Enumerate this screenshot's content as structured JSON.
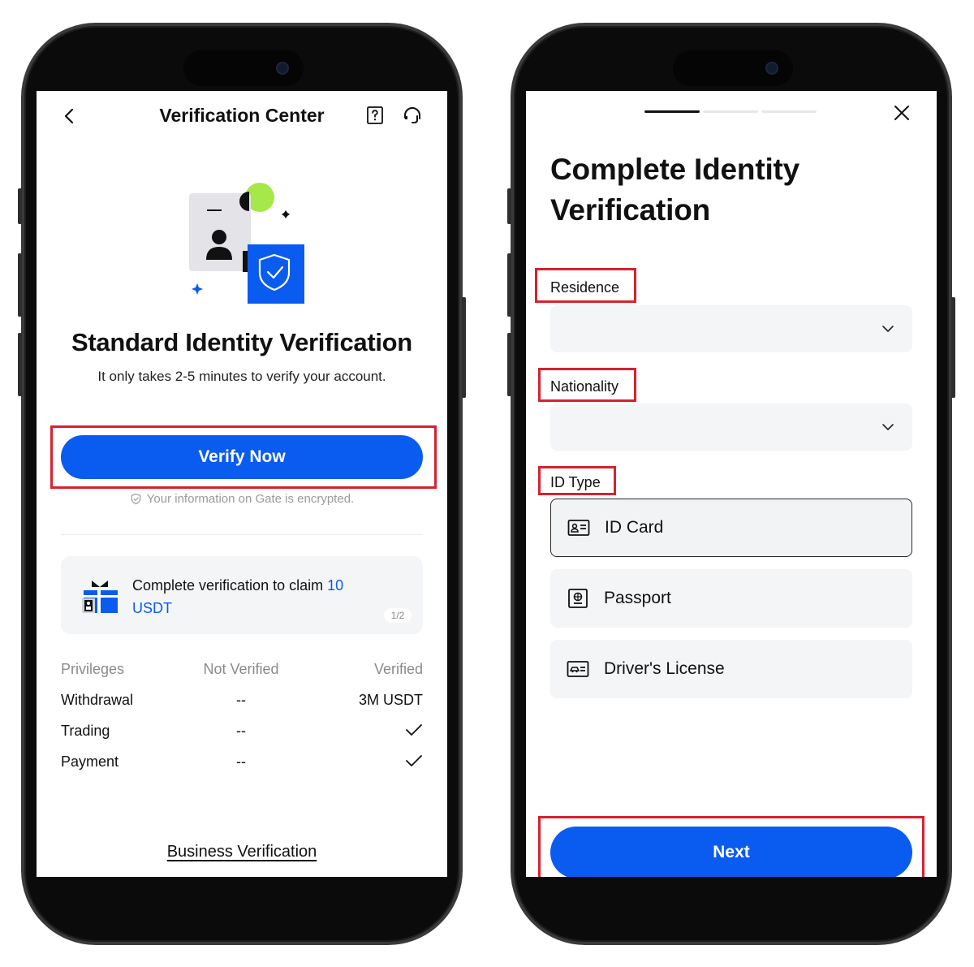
{
  "left": {
    "nav": {
      "title": "Verification Center"
    },
    "heading": "Standard Identity Verification",
    "subheading": "It only takes 2-5 minutes to verify your account.",
    "verify_button": "Verify Now",
    "encrypted_note": "Your information on Gate is encrypted.",
    "promo": {
      "text_prefix": "Complete verification to claim ",
      "amount": "10",
      "currency": "USDT",
      "page": "1/2"
    },
    "privileges": {
      "headers": [
        "Privileges",
        "Not Verified",
        "Verified"
      ],
      "rows": [
        {
          "name": "Withdrawal",
          "not_verified": "--",
          "verified": "3M USDT"
        },
        {
          "name": "Trading",
          "not_verified": "--",
          "verified": "check-icon"
        },
        {
          "name": "Payment",
          "not_verified": "--",
          "verified": "check-icon"
        }
      ]
    },
    "business_link": "Business Verification"
  },
  "right": {
    "progress": {
      "steps": 3,
      "current": 1
    },
    "heading": "Complete Identity Verification",
    "residence": {
      "label": "Residence",
      "value": ""
    },
    "nationality": {
      "label": "Nationality",
      "value": ""
    },
    "id_type": {
      "label": "ID Type",
      "options": [
        {
          "label": "ID Card",
          "icon": "id-card-icon",
          "selected": true
        },
        {
          "label": "Passport",
          "icon": "passport-icon",
          "selected": false
        },
        {
          "label": "Driver's License",
          "icon": "drivers-license-icon",
          "selected": false
        }
      ]
    },
    "next_button": "Next"
  },
  "colors": {
    "primary": "#0a5bf0",
    "highlight": "#d8212e",
    "accent_green": "#a6e84a"
  }
}
